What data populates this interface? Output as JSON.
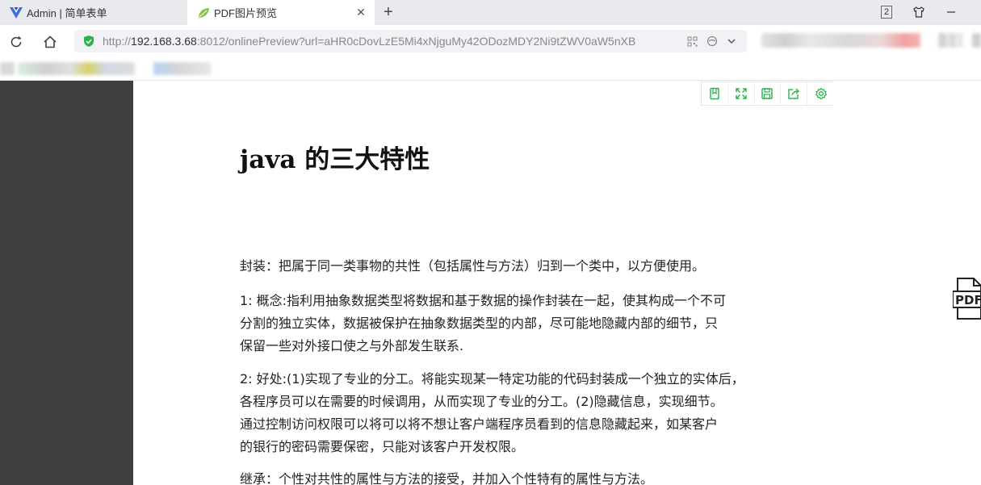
{
  "browser": {
    "tabs": [
      {
        "label": "Admin | 简单表单",
        "active": false
      },
      {
        "label": "PDF图片预览",
        "active": true
      }
    ],
    "tab_counter": "2",
    "address": {
      "scheme": "http://",
      "host": "192.168.3.68",
      "rest": ":8012/onlinePreview?url=aHR0cDovLzE5Mi4xNjguMy42ODozMDY2Ni9tZWV0aW5nXB"
    }
  },
  "viewer": {
    "toolbar_icons": [
      "bookmark-icon",
      "fullscreen-icon",
      "save-icon",
      "share-icon",
      "settings-icon"
    ],
    "badge": "PDF"
  },
  "document": {
    "title": "java 的三大特性",
    "paragraphs": [
      [
        "封装：把属于同一类事物的共性（包括属性与方法）归到一个类中，以方便使用。"
      ],
      [
        "1: 概念:指利用抽象数据类型将数据和基于数据的操作封装在一起，使其构成一个不可",
        "分割的独立实体，数据被保护在抽象数据类型的内部，尽可能地隐藏内部的细节，只",
        "保留一些对外接口使之与外部发生联系."
      ],
      [
        "2: 好处:(1)实现了专业的分工。将能实现某一特定功能的代码封装成一个独立的实体后，",
        "各程序员可以在需要的时候调用，从而实现了专业的分工。(2)隐藏信息，实现细节。",
        "通过控制访问权限可以将可以将不想让客户端程序员看到的信息隐藏起来，如某客户",
        "的银行的密码需要保密，只能对该客户开发权限。"
      ],
      [
        "继承：个性对共性的属性与方法的接受，并加入个性特有的属性与方法。"
      ]
    ]
  },
  "colors": {
    "accent_green": "#2bb24c",
    "viewer_bg": "#404040",
    "tabstrip_bg": "#e9eaee"
  }
}
